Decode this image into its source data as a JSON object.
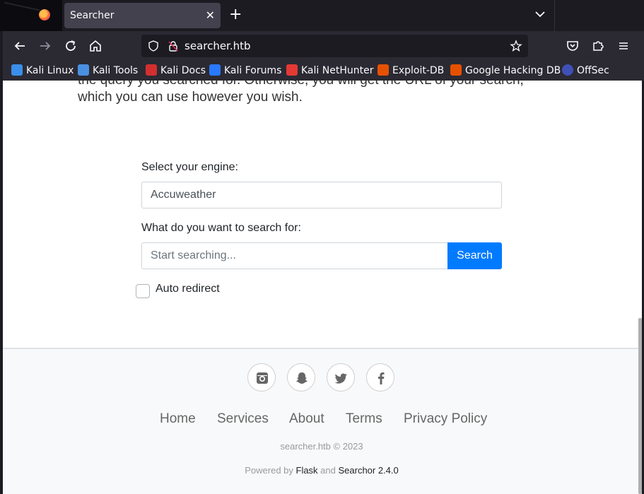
{
  "browser": {
    "tab_title": "Searcher",
    "tab_close": "✕",
    "new_tab": "+",
    "url": "searcher.htb",
    "bookmarks": [
      {
        "label": "Kali Linux",
        "icon": "kali-dragon-icon",
        "color": "#3b8eea"
      },
      {
        "label": "Kali Tools",
        "icon": "kali-tools-icon",
        "color": "#4a90e2"
      },
      {
        "label": "Kali Docs",
        "icon": "kali-docs-icon",
        "color": "#d32f2f"
      },
      {
        "label": "Kali Forums",
        "icon": "kali-forums-icon",
        "color": "#2979ff"
      },
      {
        "label": "Kali NetHunter",
        "icon": "nethunter-icon",
        "color": "#e53935"
      },
      {
        "label": "Exploit-DB",
        "icon": "exploit-db-icon",
        "color": "#e65100"
      },
      {
        "label": "Google Hacking DB",
        "icon": "ghdb-icon",
        "color": "#e65100"
      },
      {
        "label": "OffSec",
        "icon": "offsec-icon",
        "color": "#3f51b5"
      }
    ]
  },
  "page": {
    "intro_line1": "the query you searched for. Otherwise, you will get the URL of your search,",
    "intro_line2": "which you can use however you wish.",
    "engine_label": "Select your engine:",
    "engine_value": "Accuweather",
    "query_label": "What do you want to search for:",
    "query_placeholder": "Start searching...",
    "search_button": "Search",
    "auto_redirect_label": "Auto redirect",
    "accent_color": "#007bff"
  },
  "footer": {
    "social": [
      "instagram-icon",
      "snapchat-icon",
      "twitter-icon",
      "facebook-icon"
    ],
    "links": [
      "Home",
      "Services",
      "About",
      "Terms",
      "Privacy Policy"
    ],
    "copyright": "searcher.htb © 2023",
    "powered_prefix": "Powered by ",
    "powered_flask": "Flask",
    "powered_and": " and ",
    "powered_searchor": "Searchor 2.4.0"
  }
}
